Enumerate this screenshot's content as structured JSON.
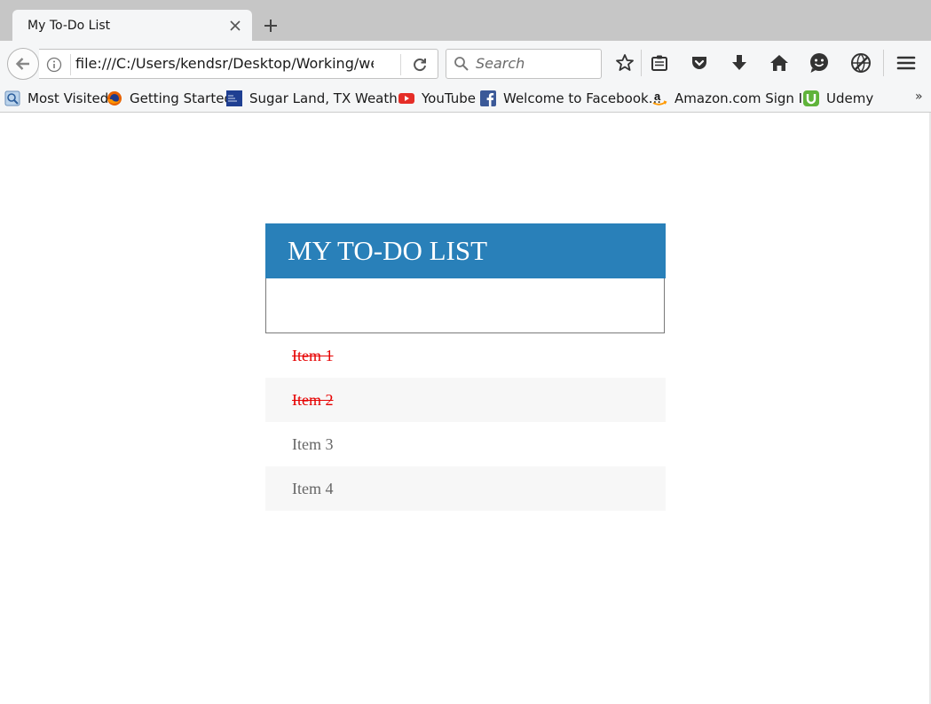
{
  "browser": {
    "tab_title": "My To-Do List",
    "url": "file:///C:/Users/kendsr/Desktop/Working/we",
    "search_placeholder": "Search",
    "bookmarks": [
      {
        "label": "Most Visited",
        "icon": "most-visited-icon"
      },
      {
        "label": "Getting Started",
        "icon": "firefox-icon"
      },
      {
        "label": "Sugar Land, TX Weath...",
        "icon": "weather-channel-icon"
      },
      {
        "label": "YouTube",
        "icon": "youtube-icon"
      },
      {
        "label": "Welcome to Facebook...",
        "icon": "facebook-icon"
      },
      {
        "label": "Amazon.com Sign In",
        "icon": "amazon-icon"
      },
      {
        "label": "Udemy",
        "icon": "udemy-icon"
      }
    ],
    "more_label": "»"
  },
  "todo": {
    "title": "MY TO-DO LIST",
    "input_placeholder": "",
    "items": [
      {
        "text": "Item 1",
        "completed": true
      },
      {
        "text": "Item 2",
        "completed": true
      },
      {
        "text": "Item 3",
        "completed": false
      },
      {
        "text": "Item 4",
        "completed": false
      }
    ]
  },
  "colors": {
    "header": "#2980b9",
    "completed_text": "#e60000",
    "item_text": "#666666",
    "even_row": "#f7f7f7"
  }
}
